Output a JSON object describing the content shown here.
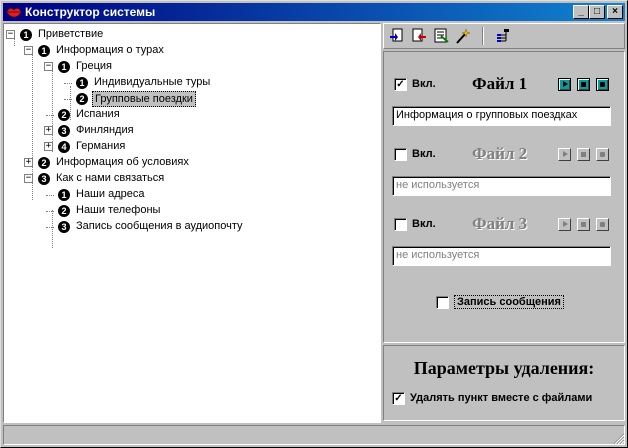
{
  "window": {
    "title": "Конструктор системы",
    "controls": {
      "minimize": "_",
      "maximize": "□",
      "close": "×"
    }
  },
  "tree": {
    "nodes": [
      {
        "num": "1",
        "label": "Приветствие",
        "expander": "−"
      },
      {
        "num": "1",
        "label": "Информация о турах",
        "expander": "−"
      },
      {
        "num": "1",
        "label": "Греция",
        "expander": "−"
      },
      {
        "num": "1",
        "label": "Индивидуальные туры"
      },
      {
        "num": "2",
        "label": "Групповые поездки",
        "selected": true
      },
      {
        "num": "2",
        "label": "Испания"
      },
      {
        "num": "3",
        "label": "Финляндия",
        "expander": "+"
      },
      {
        "num": "4",
        "label": "Германия",
        "expander": "+"
      },
      {
        "num": "2",
        "label": "Информация об условиях",
        "expander": "+"
      },
      {
        "num": "3",
        "label": "Как с нами связаться",
        "expander": "−"
      },
      {
        "num": "1",
        "label": "Наши адреса"
      },
      {
        "num": "2",
        "label": "Наши телефоны"
      },
      {
        "num": "3",
        "label": "Запись сообщения в аудиопочту"
      }
    ]
  },
  "toolbar": {
    "icons": [
      "add-item-icon",
      "delete-item-icon",
      "properties-icon",
      "wizard-icon",
      "tree-structure-icon"
    ]
  },
  "files": {
    "enable_label": "Вкл.",
    "items": [
      {
        "title": "Файл 1",
        "enabled": true,
        "check": "✓",
        "value": "Информация о групповых поездках"
      },
      {
        "title": "Файл 2",
        "enabled": false,
        "check": "",
        "value": "не используется"
      },
      {
        "title": "Файл 3",
        "enabled": false,
        "check": "",
        "value": "не используется"
      }
    ],
    "record_label": "Запись сообщения",
    "record_check": ""
  },
  "params": {
    "title": "Параметры удаления:",
    "delete_with_files_label": "Удалять пункт вместе с файлами",
    "delete_with_files_check": "✓"
  },
  "status": {
    "text": ""
  }
}
